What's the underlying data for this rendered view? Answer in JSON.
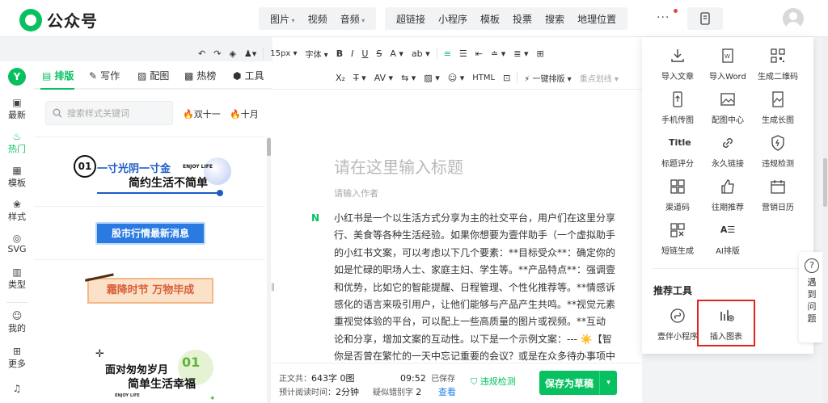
{
  "app": {
    "name": "公众号"
  },
  "topbar": {
    "group1": [
      "图片",
      "视频",
      "音频"
    ],
    "group2": [
      "超链接",
      "小程序",
      "模板",
      "投票",
      "搜索",
      "地理位置"
    ],
    "more": "···"
  },
  "left_nav": {
    "brand": "Y",
    "items": [
      {
        "icon": "▣",
        "label": "最新"
      },
      {
        "icon": "♨",
        "label": "热门"
      },
      {
        "icon": "▦",
        "label": "模板"
      },
      {
        "icon": "❀",
        "label": "样式"
      },
      {
        "icon": "◎",
        "label": "SVG"
      },
      {
        "icon": "▥",
        "label": "类型"
      },
      {
        "icon": "☺",
        "label": "我的"
      },
      {
        "icon": "⊞",
        "label": "更多"
      },
      {
        "icon": "♫",
        "label": ""
      }
    ]
  },
  "panel": {
    "tabs": [
      {
        "icon": "▤",
        "label": "排版"
      },
      {
        "icon": "✎",
        "label": "写作"
      },
      {
        "icon": "▨",
        "label": "配图"
      },
      {
        "icon": "▩",
        "label": "热榜"
      },
      {
        "icon": "⬢",
        "label": "工具"
      }
    ],
    "search_placeholder": "搜索样式关键词",
    "hot_tags": [
      "双十一",
      "十月"
    ],
    "templates": {
      "t1": {
        "num": "01",
        "top": "一寸光阴一寸金",
        "enjoy": "ENJOY LIFE",
        "bottom": "简约生活不简单"
      },
      "t2": {
        "text": "股市行情最新消息"
      },
      "t3": {
        "text": "霜降时节 万物毕成"
      },
      "t4": {
        "line1": "面对匆匆岁月",
        "num": "01",
        "line2": "简单生活幸福",
        "enjoy": "ENJOY LIFE"
      }
    }
  },
  "format_bar": {
    "row1": [
      "↶",
      "↷",
      "◈",
      "♟▾",
      "15px ▾",
      "字体 ▾",
      "B",
      "I",
      "U",
      "S",
      "A ▾",
      "ab ▾",
      "≡",
      "☰",
      "⇤",
      "≐ ▾",
      "≣ ▾",
      "⊞"
    ],
    "row2": [
      "X₂",
      "T̶ ▾",
      "AV ▾",
      "⇆ ▾",
      "▨ ▾",
      "☺ ▾",
      "HTML",
      "⊡",
      "⚡ 一键排版 ▾",
      "重点划线 ▾"
    ]
  },
  "editor": {
    "title_placeholder": "请在这里输入标题",
    "author_placeholder": "请输入作者",
    "badge": "N",
    "body_lines": [
      "小红书是一个以生活方式分享为主的社交平台，用户们在这里分享",
      "行、美食等各种生活经验。如果你想要为壹伴助手（一个虚拟助手",
      "的小红书文案，可以考虑以下几个要素：**目标受众**：确定你的",
      "如是忙碌的职场人士、家庭主妇、学生等。**产品特点**：强调壹",
      "和优势，比如它的智能提醒、日程管理、个性化推荐等。**情感诉",
      "感化的语言来吸引用户，让他们能够与产品产生共鸣。**视觉元素",
      "重视觉体验的平台，可以配上一些高质量的图片或视频。**互动",
      "论和分享，增加文案的互动性。以下是一个示例文案：--- ☀️【智",
      "你是否曾在繁忙的一天中忘记重要的会议？或是在众多待办事项中"
    ]
  },
  "bottom": {
    "word_label": "正文共：",
    "word_value": "643字 0图",
    "time": "09:52",
    "saved": "已保存",
    "read_label": "预计阅读时间：",
    "read_value": "2分钟",
    "typo_label": "疑似错别字",
    "typo_count": "2",
    "view": "查看",
    "check": "违规检测",
    "save_button": "保存为草稿",
    "caret": "▾"
  },
  "tools": {
    "items": [
      {
        "icon": "import-article-icon",
        "label": "导入文章"
      },
      {
        "icon": "import-word-icon",
        "label": "导入Word"
      },
      {
        "icon": "qrcode-icon",
        "label": "生成二维码"
      },
      {
        "icon": "phone-upload-icon",
        "label": "手机传图"
      },
      {
        "icon": "image-center-icon",
        "label": "配图中心"
      },
      {
        "icon": "long-image-icon",
        "label": "生成长图"
      },
      {
        "icon": "title-score-icon",
        "label": "标题评分",
        "glyph": "Title"
      },
      {
        "icon": "link-icon",
        "label": "永久链接"
      },
      {
        "icon": "shield-icon",
        "label": "违规检测"
      },
      {
        "icon": "channel-code-icon",
        "label": "渠道码"
      },
      {
        "icon": "thumb-up-icon",
        "label": "往期推荐"
      },
      {
        "icon": "calendar-icon",
        "label": "营销日历"
      },
      {
        "icon": "short-link-icon",
        "label": "短链生成"
      },
      {
        "icon": "ai-layout-icon",
        "label": "AI排版",
        "glyph": "A☰"
      }
    ],
    "recommended_title": "推荐工具",
    "recommended": [
      {
        "icon": "mini-program-icon",
        "label": "壹伴小程序"
      },
      {
        "icon": "insert-chart-icon",
        "label": "插入图表"
      }
    ]
  },
  "help": {
    "icon": "?",
    "label": "遇到问题"
  },
  "colors": {
    "brand": "#07c160",
    "highlight": "#e3261d",
    "link": "#1e80e8"
  }
}
